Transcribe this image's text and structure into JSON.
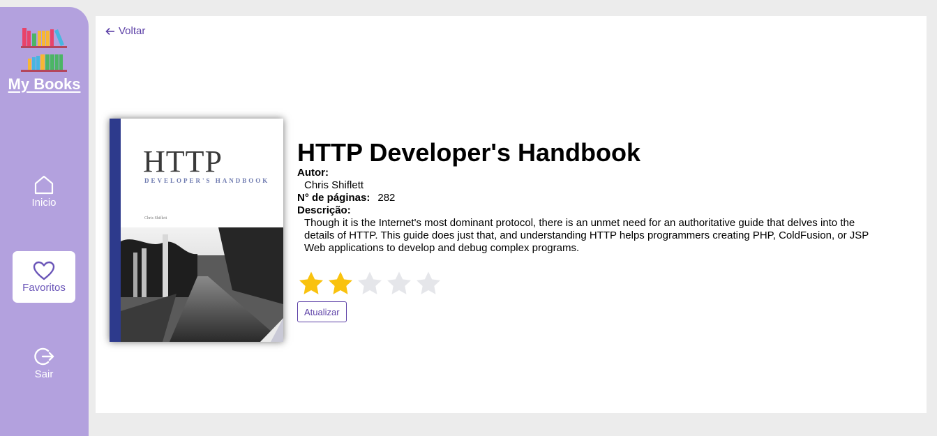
{
  "app": {
    "name": "My Books"
  },
  "sidebar": {
    "items": [
      {
        "label": "Inicio",
        "icon": "home-icon"
      },
      {
        "label": "Favoritos",
        "icon": "heart-icon",
        "active": true
      },
      {
        "label": "Sair",
        "icon": "logout-icon"
      }
    ]
  },
  "main": {
    "back_label": "Voltar"
  },
  "book": {
    "title": "HTTP Developer's Handbook",
    "author_label": "Autor:",
    "author": "Chris Shiflett",
    "pages_label": "N° de páginas:",
    "pages": "282",
    "description_label": "Descrição:",
    "description": "Though it is the Internet's most dominant protocol, there is an unmet need for an authoritative guide that delves into the details of HTTP. This guide does just that, and understanding HTTP helps programmers creating PHP, ColdFusion, or JSP Web applications to develop and debug complex programs.",
    "cover": {
      "title": "HTTP",
      "subtitle": "DEVELOPER'S HANDBOOK",
      "author": "Chris Shiflett"
    },
    "rating": 2,
    "rating_max": 5
  },
  "actions": {
    "update_label": "Atualizar"
  },
  "colors": {
    "sidebar": "#b3a1de",
    "accent": "#5b3fa6",
    "star_filled": "#f9c20e",
    "star_empty": "#e5e6ea"
  }
}
